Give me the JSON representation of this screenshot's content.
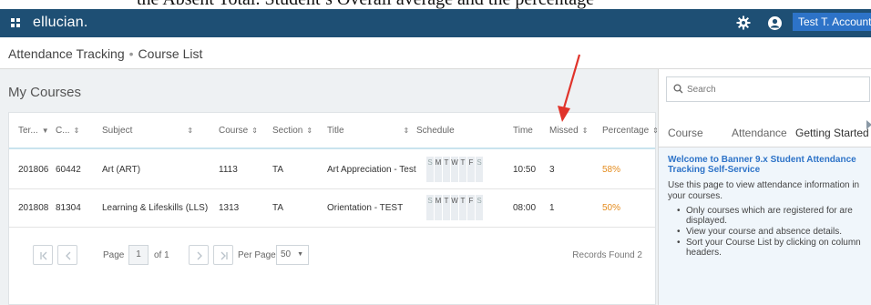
{
  "caption": {
    "text": "the Absent Total. Student’s Overall average and the percentage"
  },
  "header": {
    "brand": "ellucian.",
    "account_label": "Test T. Account-T",
    "colors": {
      "bar": "#1e4f74",
      "account_bg": "#2d73c8"
    },
    "icons": [
      "grid-icon",
      "gear-icon",
      "user-icon"
    ]
  },
  "breadcrumb": {
    "app": "Attendance Tracking",
    "separator": "•",
    "page": "Course List"
  },
  "main": {
    "title": "My Courses",
    "columns": [
      "Ter...",
      "C...",
      "Subject",
      "Course",
      "Section",
      "Title",
      "Schedule",
      "Time",
      "Missed",
      "Percentage"
    ],
    "rows": [
      {
        "term": "201806",
        "crn": "60442",
        "subject": "Art (ART)",
        "course": "1113",
        "section": "TA",
        "title": "Art Appreciation - Test",
        "schedule": [
          "S",
          "M",
          "T",
          "W",
          "T",
          "F",
          "S"
        ],
        "time": "10:50",
        "missed": "3",
        "percentage": "58%"
      },
      {
        "term": "201808",
        "crn": "81304",
        "subject": "Learning & Lifeskills (LLS)",
        "course": "1313",
        "section": "TA",
        "title": "Orientation - TEST",
        "schedule": [
          "S",
          "M",
          "T",
          "W",
          "T",
          "F",
          "S"
        ],
        "time": "08:00",
        "missed": "1",
        "percentage": "50%"
      }
    ],
    "pager": {
      "page_label": "Page",
      "page_value": "1",
      "of_label": "of 1",
      "per_page_label": "Per Page",
      "per_page_value": "50",
      "records": "Records Found 2"
    },
    "colors": {
      "percentage": "#e48b1c"
    }
  },
  "sidebar": {
    "search_placeholder": "Search",
    "tabs": [
      "Course",
      "Attendance",
      "Getting Started"
    ],
    "active_tab": "Getting Started",
    "welcome_title": "Welcome to Banner 9.x Student Attendance Tracking Self-Service",
    "intro": "Use this page to view attendance information in your courses.",
    "bullets": [
      "Only courses which are registered for are displayed.",
      "View your course and absence details.",
      "Sort your Course List by clicking on column headers."
    ],
    "colors": {
      "title": "#2d73c8",
      "info_bg": "#f0f6fb"
    }
  },
  "annotation": {
    "arrow_color": "#e0332a"
  }
}
